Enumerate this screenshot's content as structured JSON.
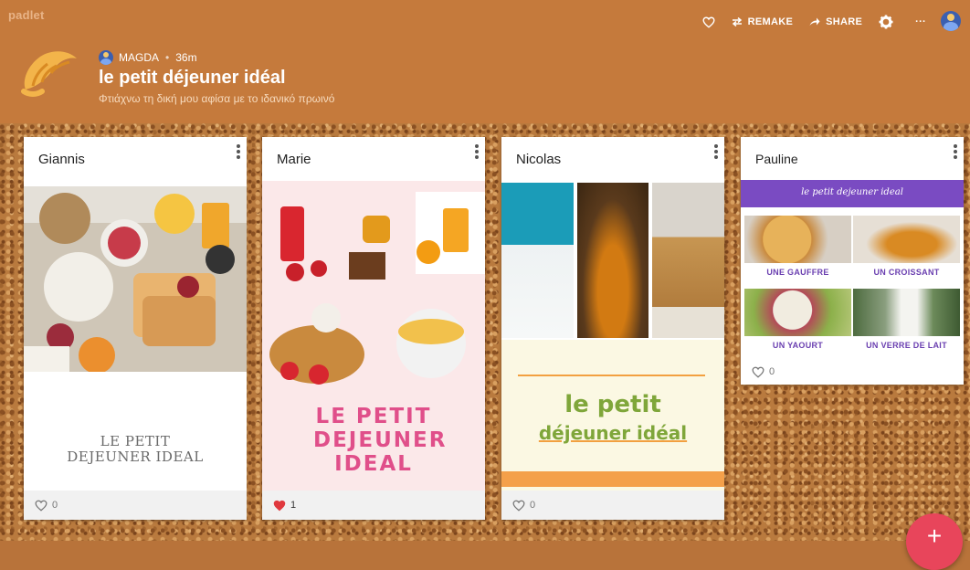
{
  "app": {
    "logo": "padlet"
  },
  "toolbar": {
    "remake_label": "REMAKE",
    "share_label": "SHARE",
    "more_label": "···"
  },
  "wall": {
    "author": "MAGDA",
    "time": "36m",
    "title": "le petit déjeuner idéal",
    "subtitle": "Φτιάχνω τη δική μου αφίσα με το ιδανικό πρωινό"
  },
  "posts": [
    {
      "author": "Giannis",
      "caption": "LE PETIT DEJEUNER IDEAL",
      "likes": "0",
      "liked": false
    },
    {
      "author": "Marie",
      "caption": "LE PETIT DEJEUNER IDEAL",
      "likes": "1",
      "liked": true
    },
    {
      "author": "Nicolas",
      "caption_line1": "le petit",
      "caption_line2": "déjeuner idéal",
      "likes": "0",
      "liked": false
    },
    {
      "author": "Pauline",
      "banner": "le petit dejeuner ideal",
      "items": [
        "UNE GAUFFRE",
        "UN CROISSANT",
        "UN YAOURT",
        "UN VERRE DE LAIT"
      ],
      "likes": "0",
      "liked": false
    }
  ],
  "fab": {
    "label": "+"
  },
  "colors": {
    "header": "#c57a3c",
    "cork": "#b97a3e",
    "like_active": "#e0393e",
    "fab": "#e8455b"
  }
}
